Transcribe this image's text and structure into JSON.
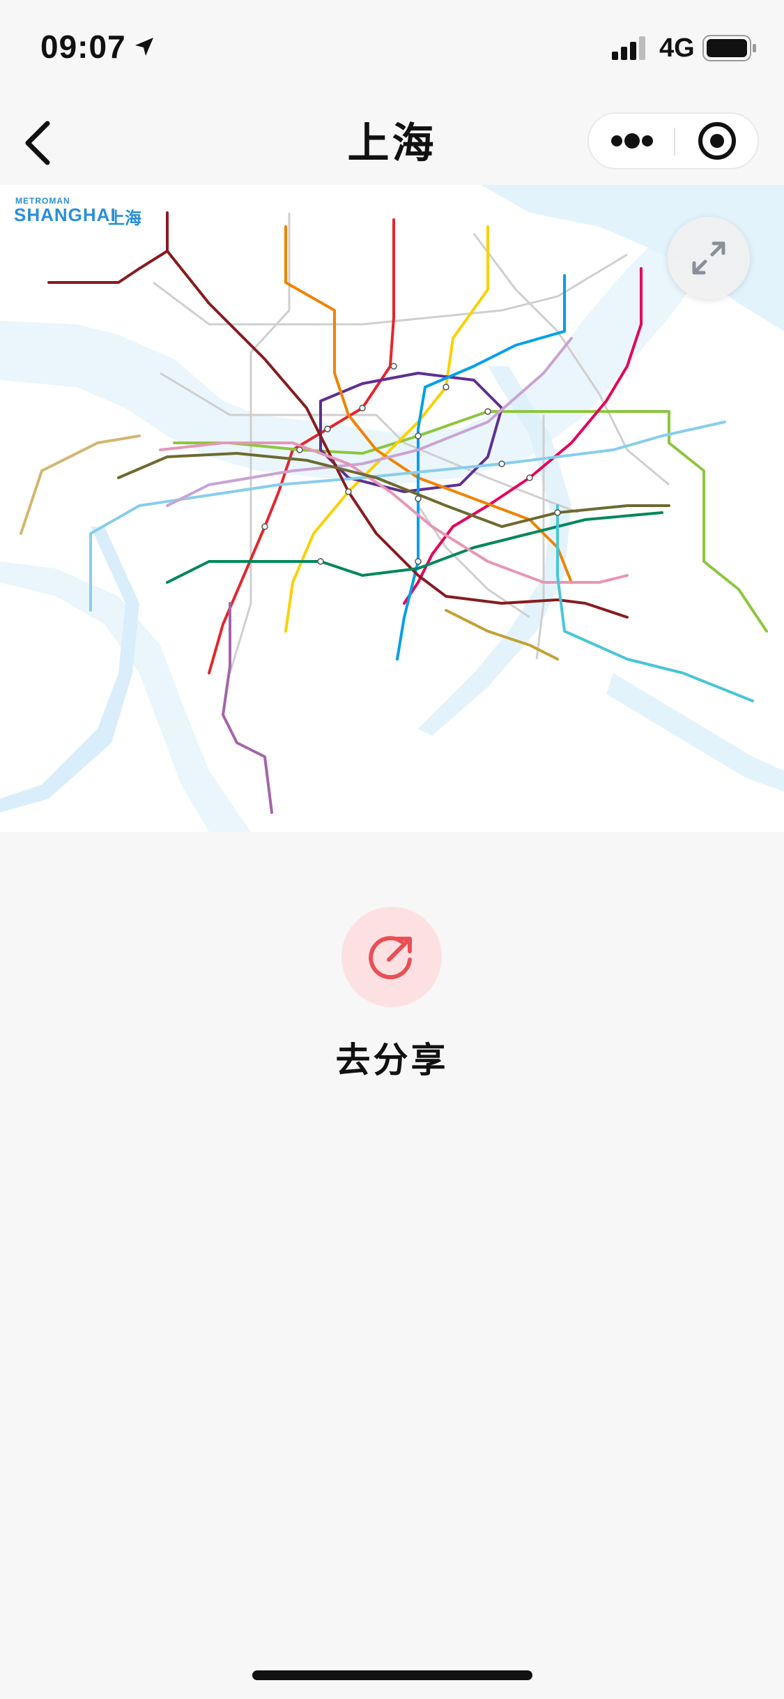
{
  "status_bar": {
    "time": "09:07",
    "network": "4G",
    "icons": [
      "location-arrow-icon",
      "signal-bars-icon",
      "battery-icon"
    ]
  },
  "nav": {
    "title": "上海",
    "icons": [
      "back-chevron-icon",
      "more-dots-icon",
      "target-close-icon"
    ]
  },
  "map": {
    "brand_small": "METROMAN",
    "brand_big": "SHANGHAI",
    "brand_city": "上海",
    "line_colors": [
      "#e4262b",
      "#8cc63f",
      "#fcd000",
      "#5f2f91",
      "#a464a8",
      "#e5005a",
      "#f08300",
      "#00a0e9",
      "#87ceeb",
      "#c9a3d4",
      "#861c20",
      "#00875a",
      "#e796b8",
      "#6c6a2f",
      "#b3d7f0",
      "#48c6d8",
      "#b8860b",
      "#999999"
    ],
    "expand_icon": "expand-arrows-icon"
  },
  "share": {
    "label": "去分享",
    "icon": "share-arrow-icon",
    "accent": "#e94f55",
    "bg": "#fde1e2"
  }
}
